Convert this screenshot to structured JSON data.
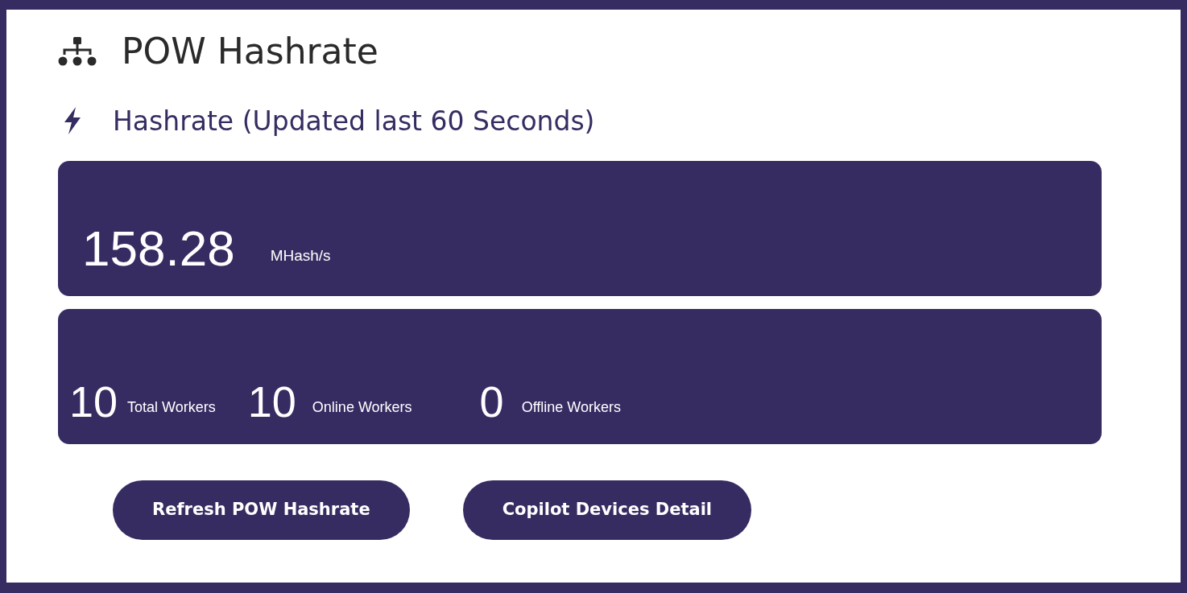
{
  "title": "POW Hashrate",
  "subtitle": "Hashrate (Updated last 60 Seconds)",
  "hashrate": {
    "value": "158.28",
    "unit": "MHash/s"
  },
  "workers": [
    {
      "value": "10",
      "label": "Total Workers"
    },
    {
      "value": "10",
      "label": "Online Workers"
    },
    {
      "value": "0",
      "label": "Offline Workers"
    }
  ],
  "buttons": [
    "Refresh POW Hashrate",
    "Copilot Devices Detail"
  ]
}
